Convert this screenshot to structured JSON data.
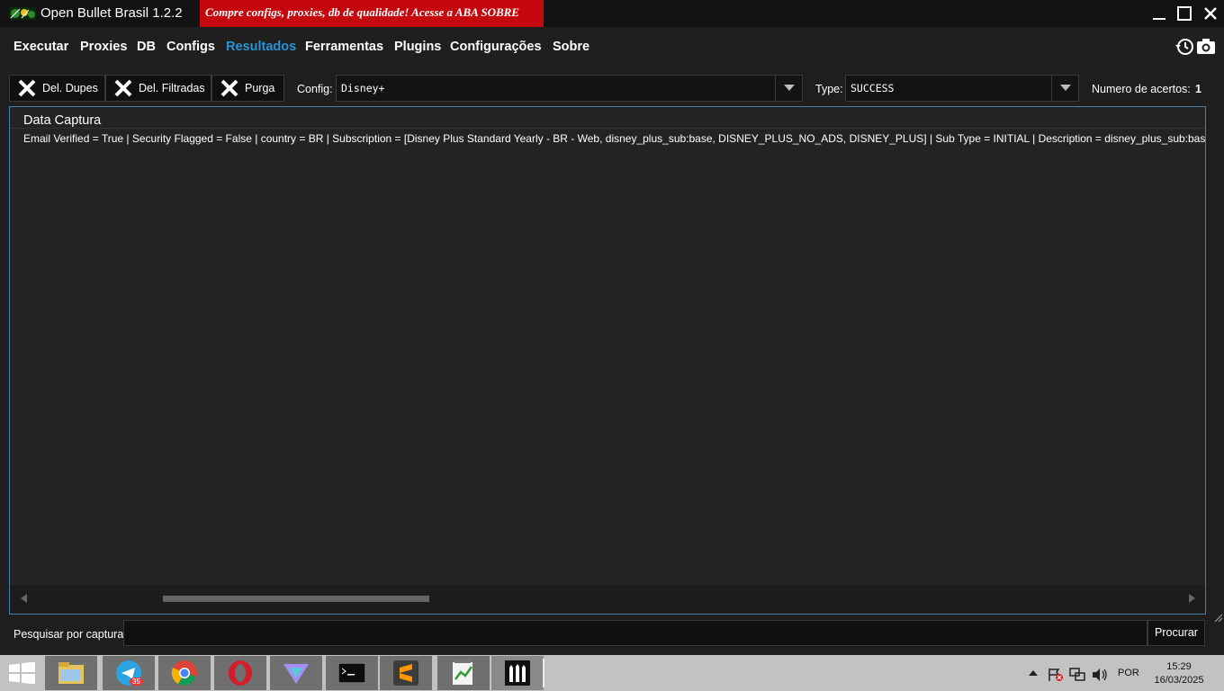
{
  "window": {
    "title": "Open Bullet Brasil 1.2.2",
    "promo": "Compre configs, proxies, db de qualidade!  Acesse a ABA SOBRE"
  },
  "menu": {
    "items": [
      {
        "label": "Executar"
      },
      {
        "label": "Proxies"
      },
      {
        "label": "DB"
      },
      {
        "label": "Configs"
      },
      {
        "label": "Resultados",
        "active": true
      },
      {
        "label": "Ferramentas"
      },
      {
        "label": "Plugins"
      },
      {
        "label": "Configurações"
      },
      {
        "label": "Sobre"
      }
    ]
  },
  "toolbar": {
    "del_dupes": "Del. Dupes",
    "del_filtradas": "Del. Filtradas",
    "purga": "Purga",
    "config_label": "Config:",
    "config_value": "Disney+",
    "type_label": "Type:",
    "type_value": "SUCCESS",
    "hits_label": "Numero de acertos:",
    "hits_count": "1"
  },
  "panel": {
    "header": "Data Captura",
    "rows": [
      "Email Verified = True | Security Flagged = False | country = BR | Subscription = [Disney Plus Standard Yearly - BR - Web, disney_plus_sub:base, DISNEY_PLUS_NO_ADS, DISNEY_PLUS] | Sub Type = INITIAL | Description = disney_plus_sub:base | Expire Date"
    ]
  },
  "search": {
    "label": "Pesquisar por captura:",
    "value": "",
    "button": "Procurar"
  },
  "taskbar": {
    "telegram_badge": "35",
    "language": "POR",
    "time": "15:29",
    "date": "16/03/2025"
  },
  "colors": {
    "accent": "#2a93d5",
    "promo_bg": "#c5080d",
    "panel_border": "#4a7fa8"
  }
}
